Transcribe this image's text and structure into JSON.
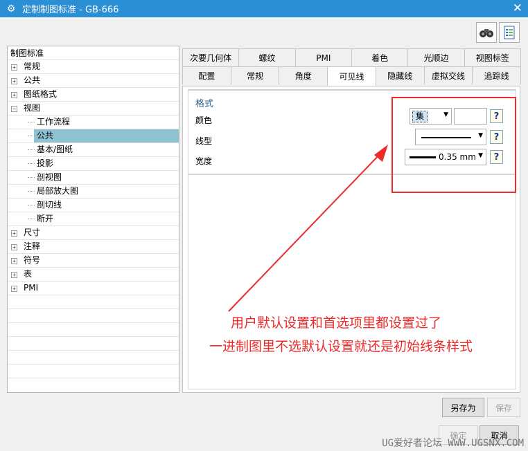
{
  "window": {
    "title": "定制制图标准 - GB-666",
    "close_glyph": "✕"
  },
  "toolbar": {
    "icon1": "binoculars-icon",
    "icon2": "document-list-icon"
  },
  "tree": {
    "header": "制图标准",
    "items": [
      {
        "label": "常规",
        "level": 0,
        "exp": "+"
      },
      {
        "label": "公共",
        "level": 0,
        "exp": "+"
      },
      {
        "label": "图纸格式",
        "level": 0,
        "exp": "+"
      },
      {
        "label": "视图",
        "level": 0,
        "exp": "−"
      },
      {
        "label": "工作流程",
        "level": 1
      },
      {
        "label": "公共",
        "level": 1,
        "selected": true
      },
      {
        "label": "基本/图纸",
        "level": 1
      },
      {
        "label": "投影",
        "level": 1
      },
      {
        "label": "剖视图",
        "level": 1
      },
      {
        "label": "局部放大图",
        "level": 1
      },
      {
        "label": "剖切线",
        "level": 1
      },
      {
        "label": "断开",
        "level": 1
      },
      {
        "label": "尺寸",
        "level": 0,
        "exp": "+"
      },
      {
        "label": "注释",
        "level": 0,
        "exp": "+"
      },
      {
        "label": "符号",
        "level": 0,
        "exp": "+"
      },
      {
        "label": "表",
        "level": 0,
        "exp": "+"
      },
      {
        "label": "PMI",
        "level": 0,
        "exp": "+"
      }
    ]
  },
  "tabs": {
    "row1": [
      "次要几何体",
      "螺纹",
      "PMI",
      "着色",
      "光顺边",
      "视图标签"
    ],
    "row2": [
      "配置",
      "常规",
      "角度",
      "可见线",
      "隐藏线",
      "虚拟交线",
      "追踪线"
    ],
    "active": "可见线"
  },
  "format": {
    "title": "格式",
    "color_label": "颜色",
    "color_value": "集",
    "linetype_label": "线型",
    "width_label": "宽度",
    "width_value": "0.35 mm",
    "help_glyph": "?"
  },
  "annotation": {
    "line1": "用户默认设置和首选项里都设置过了",
    "line2": "一进制图里不选默认设置就还是初始线条样式",
    "color": "#ee2a2a"
  },
  "buttons": {
    "save_as": "另存为",
    "save": "保存",
    "ok": "确定",
    "cancel": "取消"
  },
  "watermark": "UG爱好者论坛 WWW.UGSNX.COM"
}
